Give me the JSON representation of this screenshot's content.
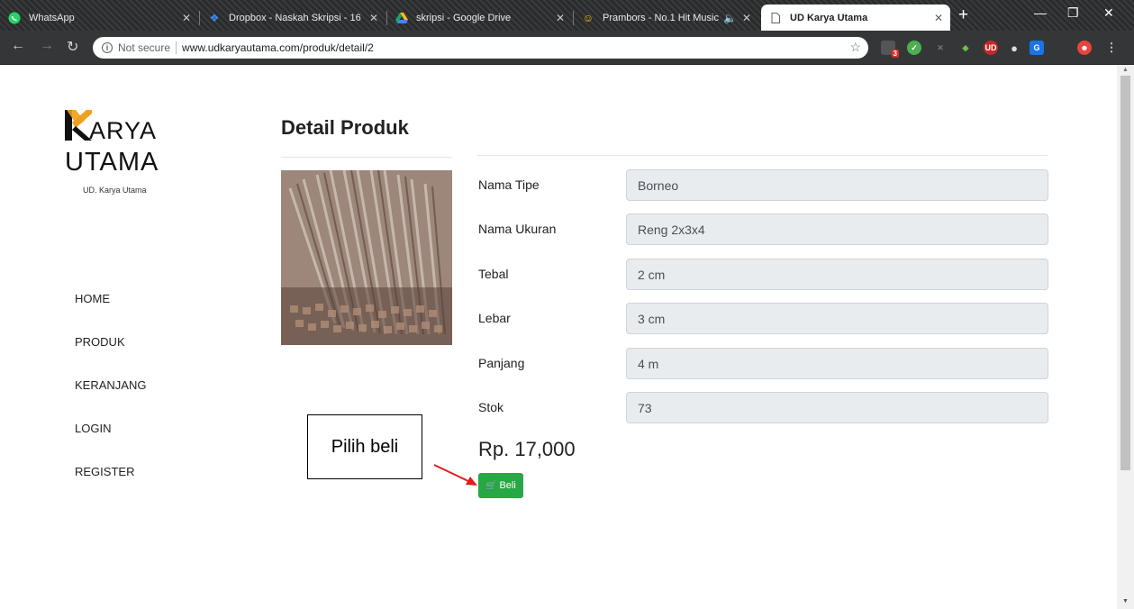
{
  "browser": {
    "tabs": [
      {
        "title": "WhatsApp",
        "icon": "whatsapp-icon",
        "icon_color": "#25d366"
      },
      {
        "title": "Dropbox - Naskah Skripsi - 16",
        "icon": "dropbox-icon",
        "icon_color": "#0061fe"
      },
      {
        "title": "skripsi - Google Drive",
        "icon": "google-drive-icon",
        "icon_color": "#f4b400"
      },
      {
        "title": "Prambors - No.1 Hit Music",
        "icon": "prambors-icon",
        "icon_color": "#f5c400"
      },
      {
        "title": "UD Karya Utama",
        "icon": "page-icon",
        "icon_color": "#5f6368"
      }
    ],
    "url_security": "Not secure",
    "url": "www.udkaryautama.com/produk/detail/2",
    "extension_badge": "3"
  },
  "logo": {
    "line1": "ARYA",
    "line2": "UTAMA",
    "subtitle": "UD. Karya Utama",
    "accent_color": "#f0a020"
  },
  "nav": {
    "items": [
      "HOME",
      "PRODUK",
      "KERANJANG",
      "LOGIN",
      "REGISTER"
    ]
  },
  "main": {
    "title": "Detail Produk",
    "fields": [
      {
        "label": "Nama Tipe",
        "value": "Borneo"
      },
      {
        "label": "Nama Ukuran",
        "value": "Reng 2x3x4"
      },
      {
        "label": "Tebal",
        "value": "2 cm"
      },
      {
        "label": "Lebar",
        "value": "3 cm"
      },
      {
        "label": "Panjang",
        "value": "4 m"
      },
      {
        "label": "Stok",
        "value": "73"
      }
    ],
    "price": "Rp. 17,000",
    "buy_label": "Beli",
    "buy_color": "#28a745"
  },
  "annotation": {
    "text": "Pilih beli",
    "arrow_color": "#e31a1c"
  }
}
